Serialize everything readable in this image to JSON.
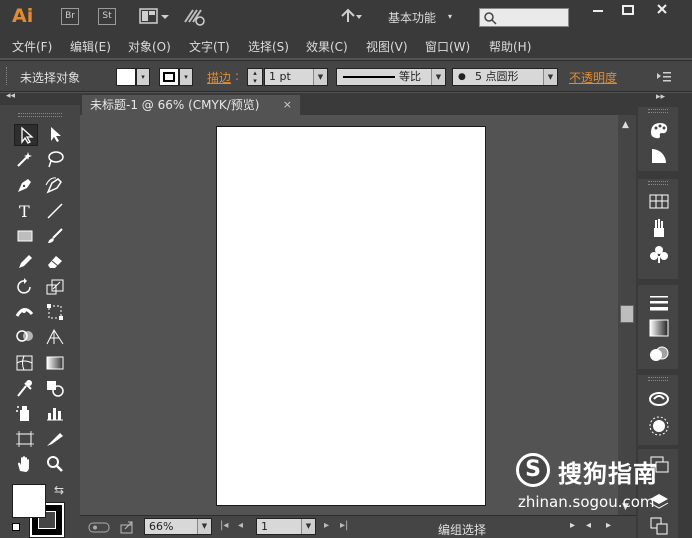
{
  "app": {
    "logo": "Ai",
    "bridge_label": "Br",
    "stock_label": "St",
    "workspace_label": "基本功能",
    "workspace_caret": "▾",
    "search_placeholder": "",
    "brand_color": "#e48b2f"
  },
  "menu": [
    "文件(F)",
    "编辑(E)",
    "对象(O)",
    "文字(T)",
    "选择(S)",
    "效果(C)",
    "视图(V)",
    "窗口(W)",
    "帮助(H)"
  ],
  "control": {
    "selection_status": "未选择对象",
    "stroke_label": "描边",
    "stroke_colon": ":",
    "stroke_weight": "1 pt",
    "stroke_profile": "等比",
    "brush": "5 点圆形",
    "opacity_label": "不透明度",
    "brush_bullet": "●"
  },
  "document": {
    "tab_title": "未标题-1 @ 66% (CMYK/预览)",
    "tab_close": "×"
  },
  "statusbar": {
    "zoom": "66%",
    "artboard_number": "1",
    "status_text": "编组选择"
  },
  "panel_collapse": "◂◂",
  "right_collapse": "▸▸",
  "fill_swap": "⇆",
  "watermark": {
    "symbol": "S",
    "title": "搜狗指南",
    "url": "zhinan.sogou.com"
  }
}
